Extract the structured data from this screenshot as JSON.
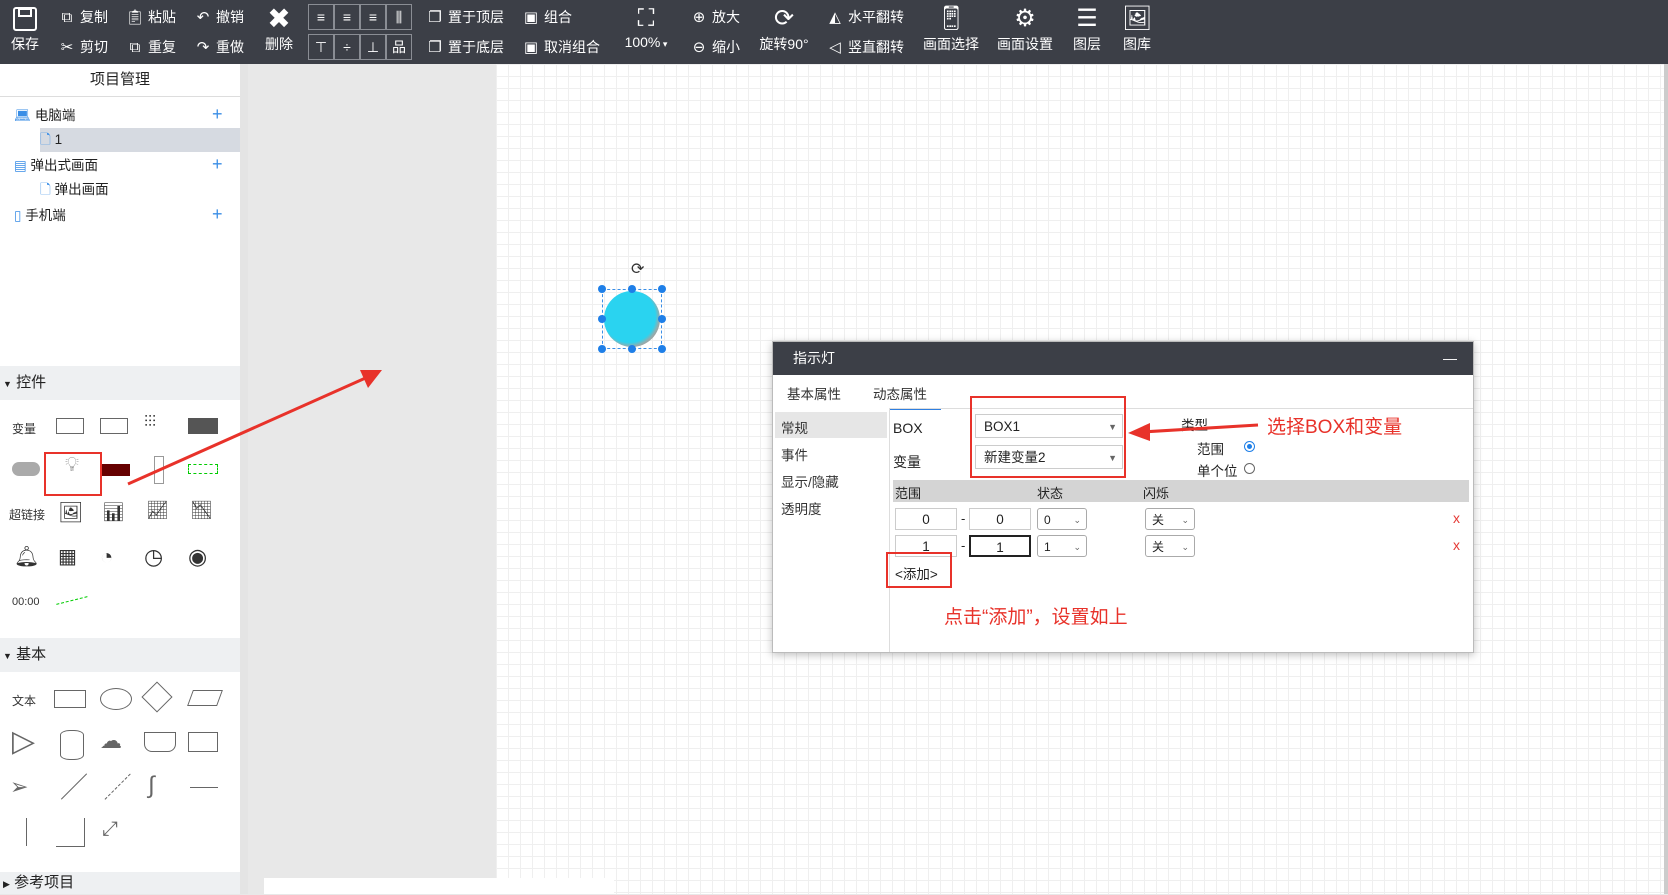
{
  "toolbar": {
    "save": "保存",
    "copy": "复制",
    "paste": "粘贴",
    "undo": "撤销",
    "cut": "剪切",
    "duplicate": "重复",
    "redo": "重做",
    "delete": "删除",
    "bring_top": "置于顶层",
    "send_bottom": "置于底层",
    "group": "组合",
    "ungroup": "取消组合",
    "zoom": "100%",
    "zoom_in": "放大",
    "zoom_out": "缩小",
    "rotate": "旋转90°",
    "flip_h": "水平翻转",
    "flip_v": "竖直翻转",
    "screen_select": "画面选择",
    "screen_settings": "画面设置",
    "layers": "图层",
    "gallery": "图库"
  },
  "project": {
    "title": "项目管理",
    "tree": [
      {
        "label": "电脑端"
      },
      {
        "label": "1"
      },
      {
        "label": "弹出式画面"
      },
      {
        "label": "弹出画面"
      },
      {
        "label": "手机端"
      }
    ]
  },
  "controls": {
    "title": "控件",
    "variable": "变量",
    "hyperlink": "超链接",
    "clock": "00:00"
  },
  "basic": {
    "title": "基本",
    "text": "文本"
  },
  "reference": {
    "title": "参考项目"
  },
  "dialog": {
    "title": "指示灯",
    "minimize": "—",
    "tabs": [
      "基本属性",
      "动态属性"
    ],
    "side": [
      "常规",
      "事件",
      "显示/隐藏",
      "透明度"
    ],
    "box_label": "BOX",
    "box_value": "BOX1",
    "var_label": "变量",
    "var_value": "新建变量2",
    "type_label": "类型",
    "type_range": "范围",
    "type_bit": "单个位",
    "col_range": "范围",
    "col_state": "状态",
    "col_blink": "闪烁",
    "rows": [
      {
        "from": "0",
        "to": "0",
        "state": "0",
        "blink": "关",
        "del": "x"
      },
      {
        "from": "1",
        "to": "1",
        "state": "1",
        "blink": "关",
        "del": "x"
      }
    ],
    "dash": "-",
    "add": "<添加>"
  },
  "annotations": {
    "select_note": "选择BOX和变量",
    "add_note": "点击“添加”，设置如上"
  },
  "colors": {
    "toolbar_bg": "#3c3f47",
    "accent": "#2f7fe0",
    "annotation_red": "#e8322a",
    "lamp": "#2ad3f0"
  }
}
